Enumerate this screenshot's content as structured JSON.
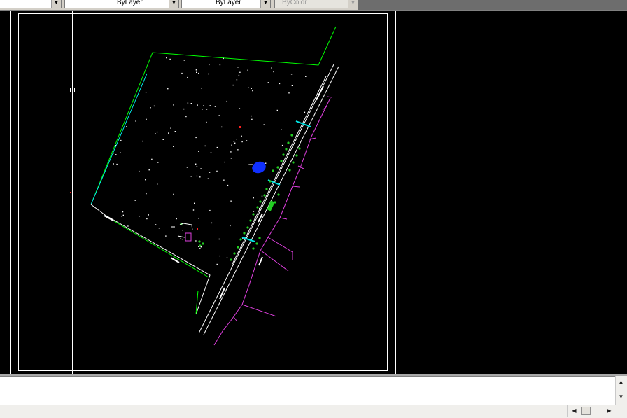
{
  "properties_toolbar": {
    "linetype_value": "ByLayer",
    "lineweight_value": "ByLayer",
    "plot_style_value": "ByColor"
  },
  "command_line": {
    "text": ""
  },
  "scroll_arrows": {
    "up": "▲",
    "down": "▼",
    "left": "◀",
    "right": "▶",
    "dropdown": "▼"
  },
  "colors": {
    "canvas_bg": "#000000",
    "crosshair": "#ffffff",
    "boundary_green": "#00ff00",
    "boundary_cyan": "#00e5e5",
    "road_lines": "#ffffff",
    "property_magenta": "#e040e0",
    "tree_green": "#22cc22",
    "pond_blue": "#1030ff",
    "marker_red": "#ff2020"
  }
}
